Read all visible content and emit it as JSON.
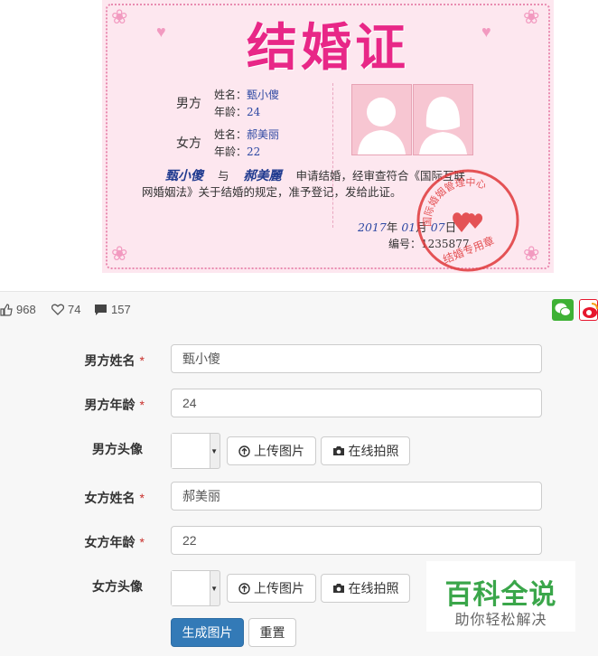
{
  "certificate": {
    "title": "结婚证",
    "groom_label": "男方",
    "bride_label": "女方",
    "name_label": "姓名：",
    "age_label": "年龄：",
    "groom_name": "甄小傻",
    "groom_age": "24",
    "bride_name": "郝美丽",
    "bride_age": "22",
    "signature_groom": "甄小傻",
    "signature_and": "与",
    "signature_bride": "郝美麗",
    "body_line1": "申请结婚，经审查符合《国际互联",
    "body_line2": "网婚姻法》关于结婚的规定，准予登记，发给此证。",
    "date_year": "2017",
    "date_year_unit": "年",
    "date_month": "01",
    "date_month_unit": "月",
    "date_day": "07",
    "date_day_unit": "日",
    "number_label": "编号：",
    "number": "1235877",
    "seal_text": "结婚专用章",
    "seal_top_text": "国际婚姻管理中心"
  },
  "stats": {
    "likes": "968",
    "favorites": "74",
    "comments": "157"
  },
  "share": {
    "wechat_color": "#3eb135",
    "weibo_color": "#e6162d"
  },
  "form": {
    "groom_name_label": "男方姓名",
    "groom_age_label": "男方年龄",
    "groom_avatar_label": "男方头像",
    "bride_name_label": "女方姓名",
    "bride_age_label": "女方年龄",
    "bride_avatar_label": "女方头像",
    "required_mark": "*",
    "groom_name_value": "甄小傻",
    "groom_age_value": "24",
    "bride_name_value": "郝美丽",
    "bride_age_value": "22",
    "upload_label": "上传图片",
    "camera_label": "在线拍照",
    "generate_label": "生成图片",
    "reset_label": "重置"
  },
  "watermark": {
    "title": "百科全说",
    "subtitle": "助你轻松解决"
  },
  "colors": {
    "primary": "#337ab7",
    "required": "#c9302c",
    "cert_title": "#e82787",
    "watermark_green": "#3aa64a"
  }
}
